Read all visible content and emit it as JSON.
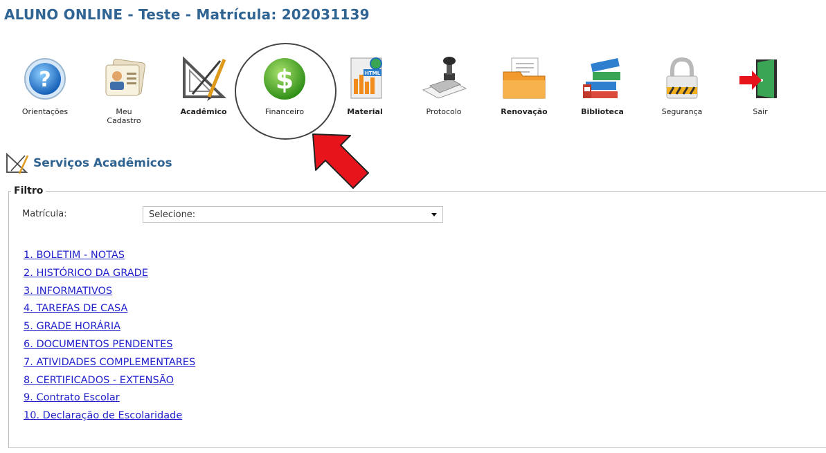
{
  "header": {
    "title": "ALUNO ONLINE - Teste - Matrícula: 202031139"
  },
  "toolbar": {
    "items": [
      {
        "label": "Orientações",
        "icon": "help-icon"
      },
      {
        "label": "Meu Cadastro",
        "icon": "id-card-icon"
      },
      {
        "label": "Acadêmico",
        "icon": "drafting-tools-icon"
      },
      {
        "label": "Financeiro",
        "icon": "dollar-icon"
      },
      {
        "label": "Material",
        "icon": "html-document-icon"
      },
      {
        "label": "Protocolo",
        "icon": "stamp-icon"
      },
      {
        "label": "Renovação",
        "icon": "folder-icon"
      },
      {
        "label": "Biblioteca",
        "icon": "books-icon"
      },
      {
        "label": "Segurança",
        "icon": "padlock-icon"
      },
      {
        "label": "Sair",
        "icon": "exit-door-icon"
      }
    ]
  },
  "section": {
    "title": "Serviços Acadêmicos",
    "icon": "drafting-tools-icon"
  },
  "filter": {
    "legend": "Filtro",
    "matricula_label": "Matrícula:",
    "select_value": "Selecione:"
  },
  "links": [
    "1. BOLETIM - NOTAS",
    "2. HISTÓRICO DA GRADE",
    "3. INFORMATIVOS",
    "4. TAREFAS DE CASA",
    "5. GRADE HORÁRIA",
    "6. DOCUMENTOS PENDENTES",
    "7. ATIVIDADES COMPLEMENTARES",
    "8. CERTIFICADOS - EXTENSÃO",
    "9. Contrato Escolar",
    "10. Declaração de Escolaridade"
  ],
  "colors": {
    "title": "#2f6493",
    "link": "#2222cc",
    "arrow": "#e8141c"
  }
}
